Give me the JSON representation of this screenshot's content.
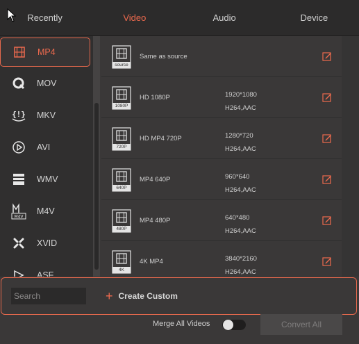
{
  "tabs": [
    {
      "label": "Recently"
    },
    {
      "label": "Video"
    },
    {
      "label": "Audio"
    },
    {
      "label": "Device"
    }
  ],
  "active_tab": "Video",
  "sidebar": {
    "items": [
      {
        "label": "MP4",
        "icon": "film-icon"
      },
      {
        "label": "MOV",
        "icon": "quicktime-icon"
      },
      {
        "label": "MKV",
        "icon": "mkv-icon"
      },
      {
        "label": "AVI",
        "icon": "play-circle-icon"
      },
      {
        "label": "WMV",
        "icon": "clapperboard-icon"
      },
      {
        "label": "M4V",
        "icon": "m4v-icon"
      },
      {
        "label": "XVID",
        "icon": "xvid-icon"
      },
      {
        "label": "ASF",
        "icon": "asf-icon"
      }
    ],
    "active": "MP4"
  },
  "formats": [
    {
      "name": "Same as source",
      "badge": "source",
      "resolution": "",
      "codec": ""
    },
    {
      "name": "HD 1080P",
      "badge": "1080P",
      "resolution": "1920*1080",
      "codec": "H264,AAC"
    },
    {
      "name": "HD MP4 720P",
      "badge": "720P",
      "resolution": "1280*720",
      "codec": "H264,AAC"
    },
    {
      "name": "MP4 640P",
      "badge": "640P",
      "resolution": "960*640",
      "codec": "H264,AAC"
    },
    {
      "name": "MP4 480P",
      "badge": "480P",
      "resolution": "640*480",
      "codec": "H264,AAC"
    },
    {
      "name": "4K MP4",
      "badge": "4K",
      "resolution": "3840*2160",
      "codec": "H264,AAC"
    }
  ],
  "search": {
    "placeholder": "Search"
  },
  "create_custom": {
    "label": "Create Custom"
  },
  "merge": {
    "label": "Merge All Videos",
    "on": false
  },
  "convert": {
    "label": "Convert All"
  },
  "colors": {
    "accent": "#ee6a4e",
    "background": "#3a3838",
    "panel": "#302f2f"
  }
}
